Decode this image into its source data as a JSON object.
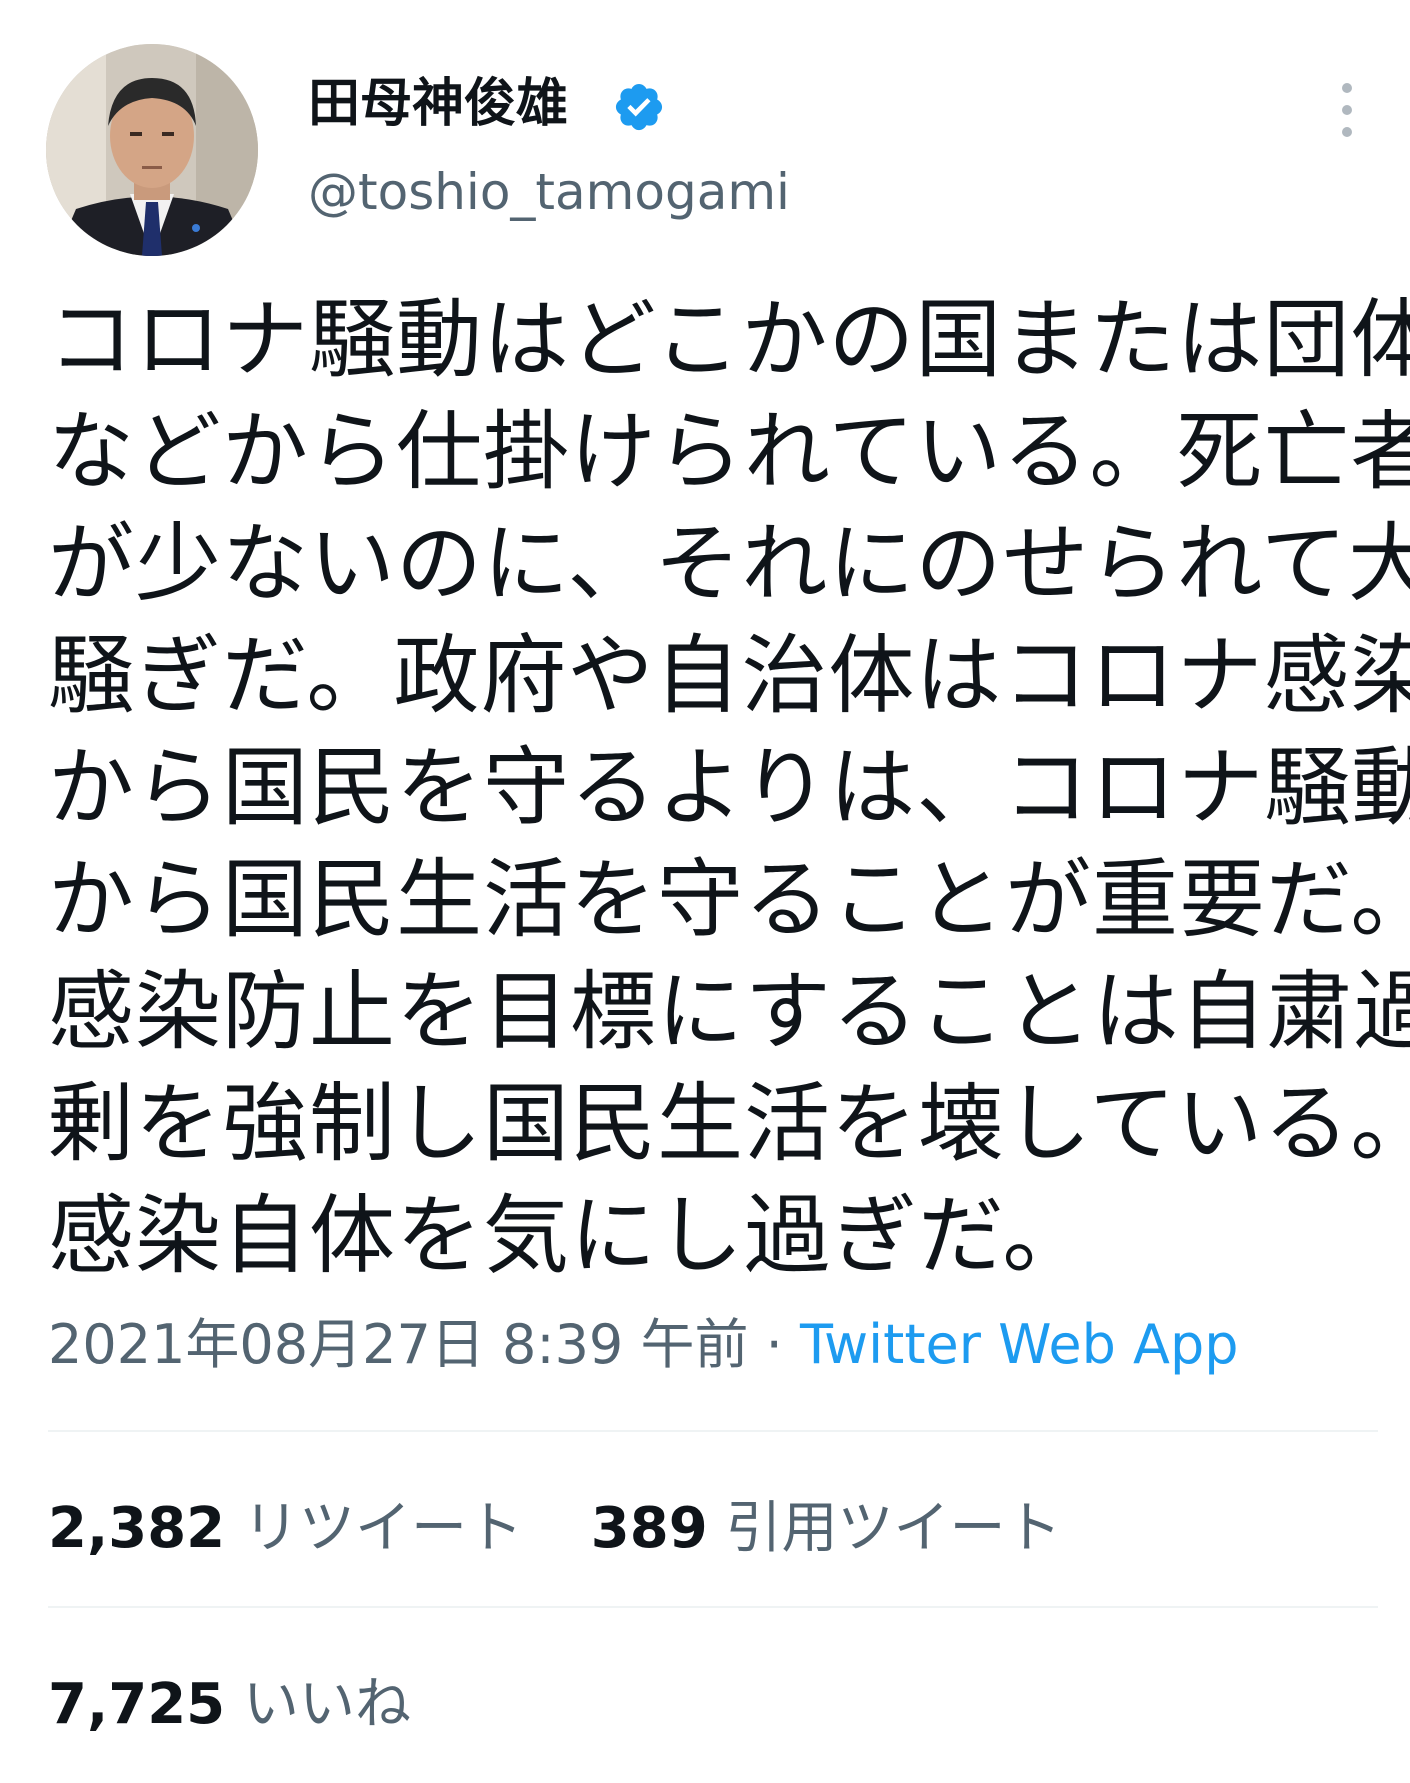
{
  "author": {
    "display_name": "田母神俊雄",
    "handle": "@toshio_tamogami",
    "verified": true,
    "avatar_icon": "profile-photo"
  },
  "tweet": {
    "lines": [
      "コロナ騒動はどこかの国または団体",
      "などから仕掛けられている。死亡者",
      "が少ないのに、それにのせられて大",
      "騒ぎだ。政府や自治体はコロナ感染",
      "から国民を守るよりは、コロナ騒動",
      "から国民生活を守ることが重要だ。",
      "感染防止を目標にすることは自粛過",
      "剰を強制し国民生活を壊している。",
      "感染自体を気にし過ぎだ。"
    ],
    "timestamp": "2021年08月27日 8:39 午前",
    "separator": "·",
    "source": "Twitter Web App"
  },
  "stats": {
    "retweets_count": "2,382",
    "retweets_label": "リツイート",
    "quotes_count": "389",
    "quotes_label": "引用ツイート",
    "likes_count": "7,725",
    "likes_label": "いいね"
  },
  "colors": {
    "text": "#0f1419",
    "secondary": "#536471",
    "accent": "#1d9bf0",
    "divider": "#eff3f4"
  }
}
